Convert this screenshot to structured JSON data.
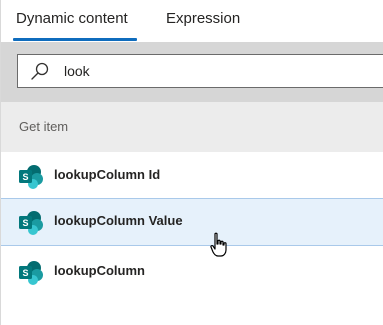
{
  "tabs": [
    {
      "label": "Dynamic content",
      "active": true
    },
    {
      "label": "Expression",
      "active": false
    }
  ],
  "search": {
    "value": "look",
    "icon": "search-icon"
  },
  "section": {
    "title": "Get item"
  },
  "items": [
    {
      "label": "lookupColumn Id",
      "icon": "sharepoint-icon",
      "highlighted": false
    },
    {
      "label": "lookupColumn Value",
      "icon": "sharepoint-icon",
      "highlighted": true
    },
    {
      "label": "lookupColumn",
      "icon": "sharepoint-icon",
      "highlighted": false
    }
  ],
  "colors": {
    "accent": "#0f6cbd",
    "search_band": "#d6d6d6",
    "section_band": "#ececec",
    "highlight": "#e6f1fb",
    "sharepoint_teal": "#038387"
  }
}
